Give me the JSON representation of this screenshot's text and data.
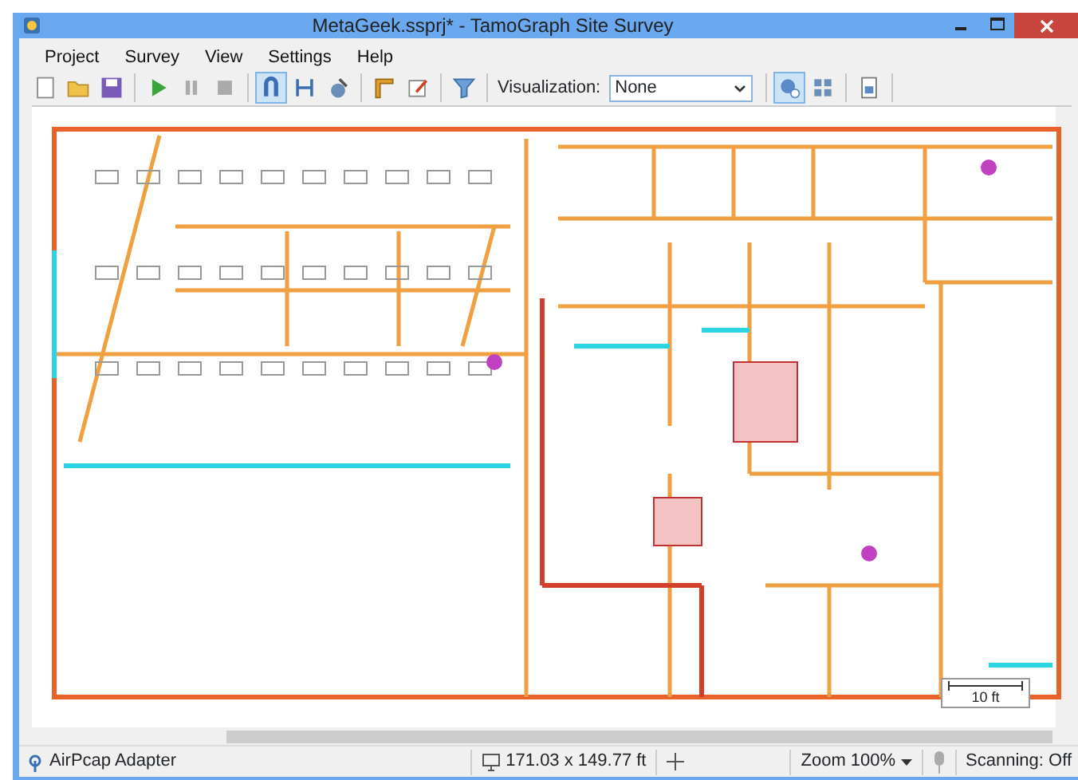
{
  "window": {
    "title": "MetaGeek.ssprj* - TamoGraph Site Survey"
  },
  "menu": [
    "Project",
    "Survey",
    "View",
    "Settings",
    "Help"
  ],
  "toolbar": [
    {
      "kind": "new",
      "selected": false
    },
    {
      "kind": "open",
      "selected": false
    },
    {
      "kind": "save",
      "selected": false
    },
    {
      "kind": "sep"
    },
    {
      "kind": "play",
      "selected": false
    },
    {
      "kind": "pause",
      "selected": false
    },
    {
      "kind": "stop",
      "selected": false
    },
    {
      "kind": "sep"
    },
    {
      "kind": "magnet",
      "selected": true
    },
    {
      "kind": "path",
      "selected": false
    },
    {
      "kind": "satellite",
      "selected": false
    },
    {
      "kind": "sep"
    },
    {
      "kind": "ruler",
      "selected": false
    },
    {
      "kind": "note",
      "selected": false
    },
    {
      "kind": "sep"
    },
    {
      "kind": "funnel",
      "selected": false
    },
    {
      "kind": "sep"
    }
  ],
  "visualization": {
    "label": "Visualization:",
    "value": "None"
  },
  "toolbar_right": [
    {
      "kind": "ap",
      "selected": true
    },
    {
      "kind": "grid",
      "selected": false
    },
    {
      "kind": "sep"
    },
    {
      "kind": "report",
      "selected": false
    },
    {
      "kind": "sep"
    }
  ],
  "scale_bar": {
    "label": "10 ft"
  },
  "status_bar": {
    "adapter": "AirPcap Adapter",
    "dimensions": "171.03 x 149.77 ft",
    "zoom": "Zoom 100%",
    "scanning": "Scanning: Off"
  }
}
